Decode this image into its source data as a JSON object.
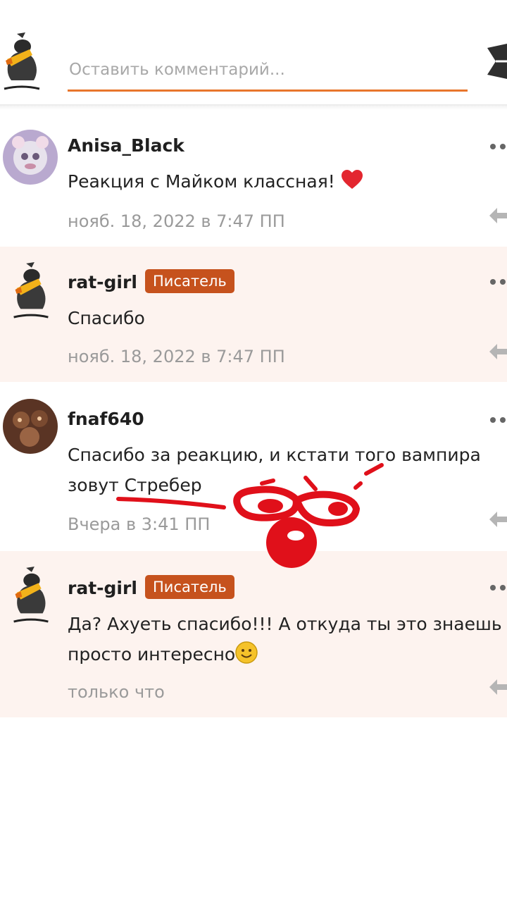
{
  "composer": {
    "placeholder": "Оставить комментарий...",
    "send_icon": "send-icon"
  },
  "comments": [
    {
      "author": "Anisa_Black",
      "badge": "",
      "text": "Реакция с Майком классная!",
      "emoji": "heart-icon",
      "time": "нояб. 18, 2022 в 7:47 ПП"
    },
    {
      "author": "rat-girl",
      "badge": "Писатель",
      "text": "Спасибо",
      "time": "нояб. 18, 2022 в 7:47 ПП"
    },
    {
      "author": "fnaf640",
      "badge": "",
      "text_line1": "Спасибо за реакцию, и кстати того вампира",
      "text_line2": "зовут Стребер",
      "time": "Вчера в 3:41 ПП"
    },
    {
      "author": "rat-girl",
      "badge": "Писатель",
      "text_line1": "Да? Ахуеть спасибо!!! А откуда ты это знаешь",
      "text_line2": "просто интересно",
      "emoji": "smile-icon",
      "time": "только что"
    }
  ],
  "colors": {
    "accent": "#e8762c",
    "badge": "#c6521d",
    "highlight_row": "#fdf3ef",
    "doodle": "#e0101a"
  }
}
